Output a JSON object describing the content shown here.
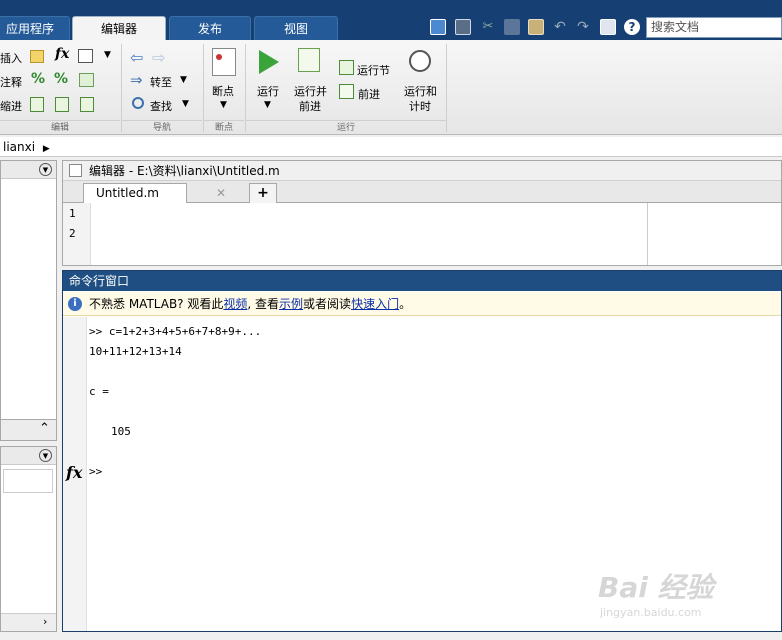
{
  "top_tabs": [
    {
      "label": "应用程序",
      "active": false
    },
    {
      "label": "编辑器",
      "active": true
    },
    {
      "label": "发布",
      "active": false
    },
    {
      "label": "视图",
      "active": false
    }
  ],
  "search": {
    "placeholder": "搜索文档"
  },
  "ribbon": {
    "edit": {
      "insert": "插入",
      "comment": "注释",
      "indent": "缩进",
      "title": "编辑"
    },
    "nav": {
      "goto": "转至",
      "find": "查找",
      "title": "导航"
    },
    "breakpoints": {
      "label": "断点",
      "title": "断点"
    },
    "run": {
      "run": "运行",
      "run_advance_1": "运行并",
      "run_advance_2": "前进",
      "run_section": "运行节",
      "advance": "前进",
      "run_time_1": "运行和",
      "run_time_2": "计时",
      "title": "运行"
    }
  },
  "address": {
    "path": "lianxi"
  },
  "editor": {
    "title": "编辑器 - E:\\资料\\lianxi\\Untitled.m",
    "tab": "Untitled.m",
    "add_tab": "+",
    "lines": [
      "1",
      "2"
    ]
  },
  "command_window": {
    "title": "命令行窗口",
    "info_prefix": "不熟悉 MATLAB? 观看此",
    "info_link1": "视频",
    "info_mid1": ", 查看",
    "info_link2": "示例",
    "info_mid2": "或者阅读",
    "info_link3": "快速入门",
    "info_suffix": "。",
    "lines": [
      ">> c=1+2+3+4+5+6+7+8+9+...",
      "10+11+12+13+14",
      "c =",
      "105",
      ">>"
    ],
    "fx": "fx"
  },
  "watermark": {
    "brand": "Bai 经验",
    "url": "jingyan.baidu.com"
  }
}
